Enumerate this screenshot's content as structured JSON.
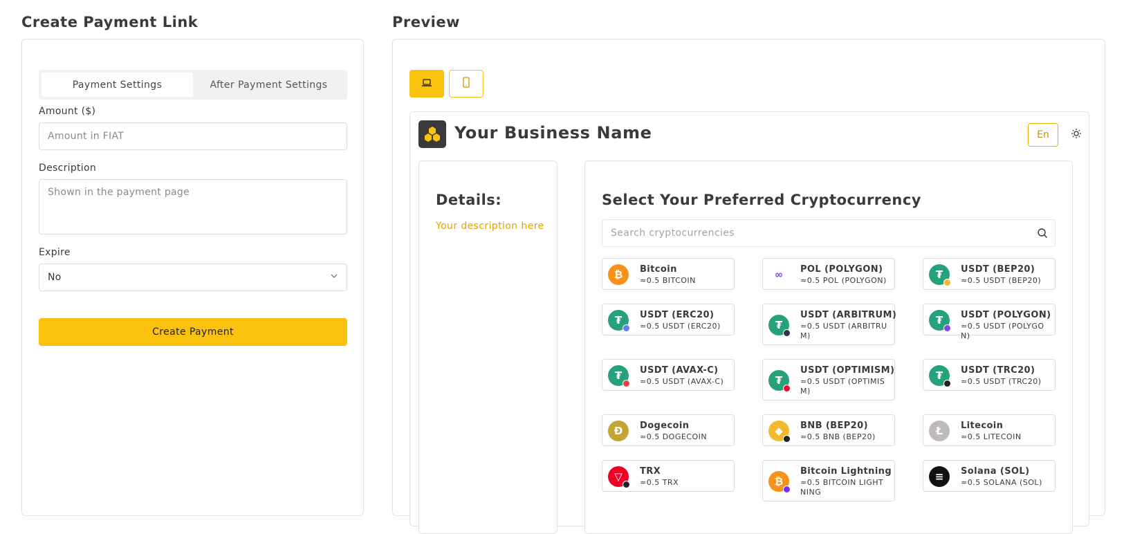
{
  "left": {
    "title": "Create Payment Link",
    "tabs": [
      {
        "label": "Payment Settings",
        "active": true
      },
      {
        "label": "After Payment Settings",
        "active": false
      }
    ],
    "amount": {
      "label": "Amount ($)",
      "placeholder": "Amount in FIAT"
    },
    "description": {
      "label": "Description",
      "placeholder": "Shown in the payment page"
    },
    "expire": {
      "label": "Expire",
      "value": "No"
    },
    "create_button": "Create Payment"
  },
  "preview": {
    "title": "Preview",
    "view_buttons": [
      {
        "name": "desktop",
        "icon": "laptop-icon",
        "active": true
      },
      {
        "name": "mobile",
        "icon": "phone-icon",
        "active": false
      }
    ],
    "business_name": "Your Business Name",
    "language": "En",
    "details": {
      "title": "Details:",
      "description": "Your description here"
    },
    "select_title": "Select Your Preferred Cryptocurrency",
    "search_placeholder": "Search cryptocurrencies",
    "coins": [
      {
        "name": "Bitcoin",
        "amount": "≈0.5 BITCOIN",
        "icon": "bitcoin-icon",
        "color": "#f7931a"
      },
      {
        "name": "POL (POLYGON)",
        "amount": "≈0.5 POL (POLYGON)",
        "icon": "polygon-icon",
        "color": "#8247e5"
      },
      {
        "name": "USDT (BEP20)",
        "amount": "≈0.5 USDT (BEP20)",
        "icon": "tether-icon",
        "color": "#26a17b",
        "badge": "#f3ba2f"
      },
      {
        "name": "USDT (ERC20)",
        "amount": "≈0.5 USDT (ERC20)",
        "icon": "tether-icon",
        "color": "#26a17b",
        "badge": "#627eea"
      },
      {
        "name": "USDT (ARBITRUM)",
        "amount": "≈0.5 USDT (ARBITRUM)",
        "icon": "tether-icon",
        "color": "#26a17b",
        "badge": "#2d374b"
      },
      {
        "name": "USDT (POLYGON)",
        "amount": "≈0.5 USDT (POLYGON)",
        "icon": "tether-icon",
        "color": "#26a17b",
        "badge": "#8247e5"
      },
      {
        "name": "USDT (AVAX-C)",
        "amount": "≈0.5 USDT (AVAX-C)",
        "icon": "tether-icon",
        "color": "#26a17b",
        "badge": "#e84142"
      },
      {
        "name": "USDT (OPTIMISM)",
        "amount": "≈0.5 USDT (OPTIMISM)",
        "icon": "tether-icon",
        "color": "#26a17b",
        "badge": "#ff0420"
      },
      {
        "name": "USDT (TRC20)",
        "amount": "≈0.5 USDT (TRC20)",
        "icon": "tether-icon",
        "color": "#26a17b",
        "badge": "#222222"
      },
      {
        "name": "Dogecoin",
        "amount": "≈0.5 DOGECOIN",
        "icon": "dogecoin-icon",
        "color": "#c2a633"
      },
      {
        "name": "BNB (BEP20)",
        "amount": "≈0.5 BNB (BEP20)",
        "icon": "bnb-icon",
        "color": "#f3ba2f",
        "badge": "#222222"
      },
      {
        "name": "Litecoin",
        "amount": "≈0.5 LITECOIN",
        "icon": "litecoin-icon",
        "color": "#bfbbbb"
      },
      {
        "name": "TRX",
        "amount": "≈0.5 TRX",
        "icon": "tron-icon",
        "color": "#ef0027",
        "badge": "#222222"
      },
      {
        "name": "Bitcoin Lightning",
        "amount": "≈0.5 BITCOIN LIGHTNING",
        "icon": "bitcoin-lightning-icon",
        "color": "#f7931a",
        "badge": "#7b2bf9"
      },
      {
        "name": "Solana (SOL)",
        "amount": "≈0.5 SOLANA (SOL)",
        "icon": "solana-icon",
        "color": "#111111"
      }
    ]
  },
  "colors": {
    "accent": "#f8c20f",
    "accent_text": "#e3a300",
    "border": "#e2e2e2"
  }
}
